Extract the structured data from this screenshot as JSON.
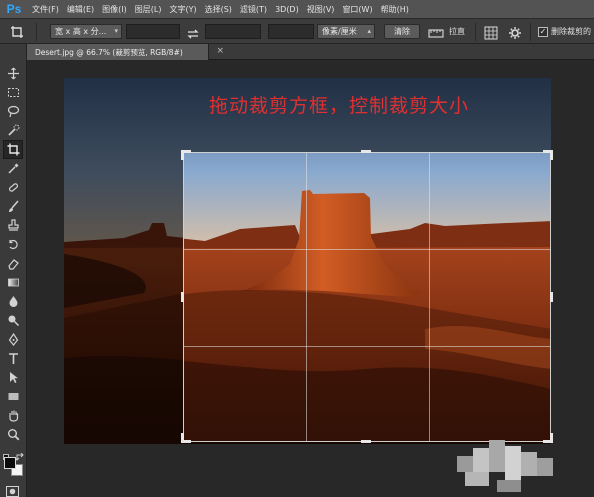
{
  "app": {
    "logo": "Ps"
  },
  "menu": [
    "文件(F)",
    "编辑(E)",
    "图像(I)",
    "图层(L)",
    "文字(Y)",
    "选择(S)",
    "滤镜(T)",
    "3D(D)",
    "视图(V)",
    "窗口(W)",
    "帮助(H)"
  ],
  "options": {
    "ratio_label": "宽 x 高 x 分...",
    "unit_label": "像素/厘米",
    "clear_label": "清除",
    "straighten_label": "拉直",
    "delete_cropped_label": "删除裁剪的",
    "delete_cropped_checked": "✓"
  },
  "document": {
    "tab_title": "Desert.jpg @ 66.7% (裁剪预览, RGB/8#)",
    "close_glyph": "×"
  },
  "tools": [
    "move-icon",
    "marquee-icon",
    "lasso-icon",
    "quick-select-icon",
    "crop-icon",
    "eyedropper-icon",
    "healing-brush-icon",
    "brush-icon",
    "clone-stamp-icon",
    "history-brush-icon",
    "eraser-icon",
    "gradient-icon",
    "blur-icon",
    "dodge-icon",
    "pen-icon",
    "type-icon",
    "path-select-icon",
    "rectangle-icon",
    "hand-icon",
    "zoom-icon"
  ],
  "canvas": {
    "instruction": "拖动裁剪方框，控制裁剪大小"
  },
  "colors": {
    "instruction_text": "#e03030",
    "ps_blue": "#31a8ff",
    "sky_top": "#6f8fb8",
    "rock": "#b8451c"
  }
}
